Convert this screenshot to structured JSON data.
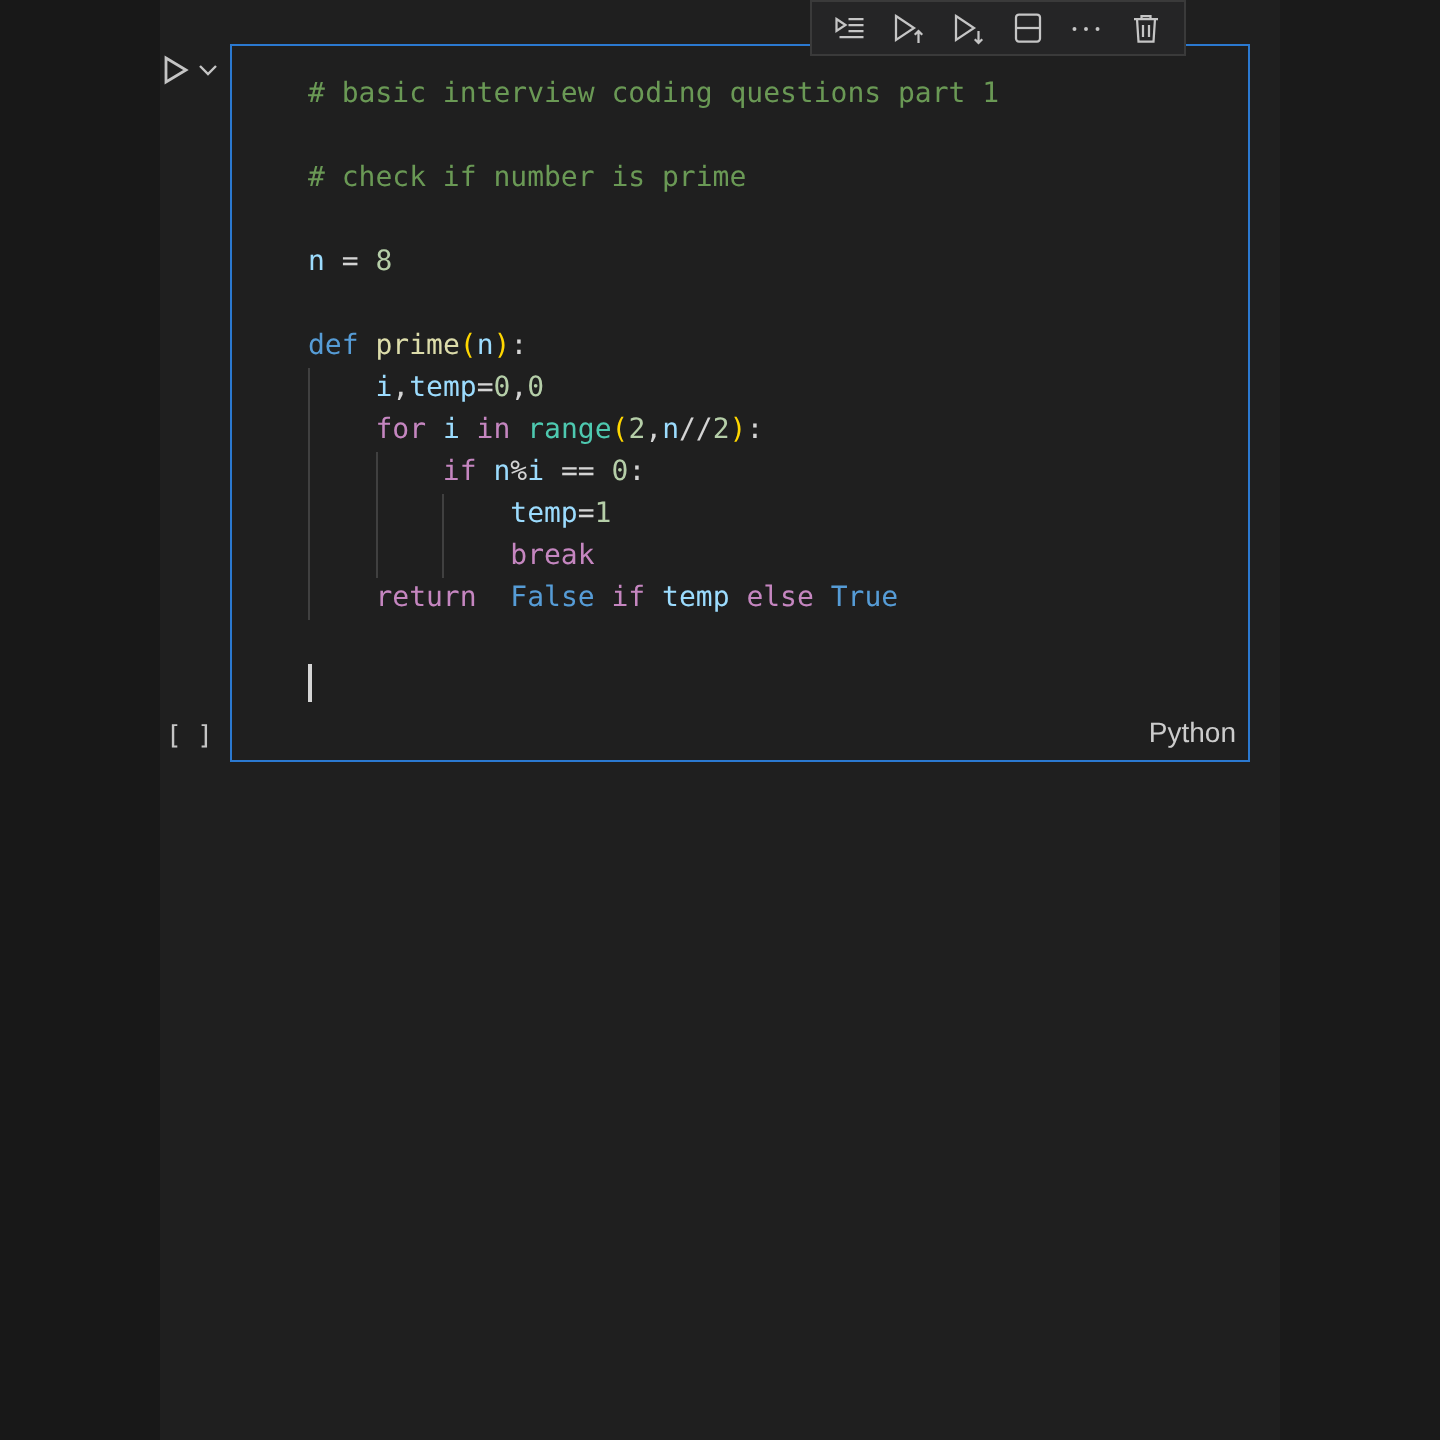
{
  "toolbar": {
    "buttons": [
      {
        "kind": "run-by-line"
      },
      {
        "kind": "run-above"
      },
      {
        "kind": "run-below"
      },
      {
        "kind": "split"
      },
      {
        "kind": "more"
      },
      {
        "kind": "delete"
      }
    ]
  },
  "cell": {
    "selected": true,
    "execution_count": "[ ]",
    "language": "Python",
    "lines": [
      {
        "kind": "code",
        "tokens": [
          {
            "text": "# basic interview coding questions part 1",
            "kind": "comment"
          }
        ]
      },
      {
        "kind": "blank"
      },
      {
        "kind": "code",
        "tokens": [
          {
            "text": "# check if number is prime",
            "kind": "comment"
          }
        ]
      },
      {
        "kind": "blank"
      },
      {
        "kind": "code",
        "tokens": [
          {
            "text": "n",
            "kind": "variable"
          },
          {
            "text": " = ",
            "kind": "plain"
          },
          {
            "text": "8",
            "kind": "number"
          }
        ]
      },
      {
        "kind": "blank"
      },
      {
        "kind": "code",
        "tokens": [
          {
            "text": "def",
            "kind": "storage"
          },
          {
            "text": " prime",
            "kind": "function"
          },
          {
            "text": "(",
            "kind": "bracket"
          },
          {
            "text": "n",
            "kind": "variable"
          },
          {
            "text": ")",
            "kind": "bracket"
          },
          {
            "text": ":",
            "kind": "plain"
          }
        ]
      },
      {
        "kind": "code",
        "tokens": [
          {
            "text": "    i",
            "kind": "variable"
          },
          {
            "text": ",",
            "kind": "plain"
          },
          {
            "text": "temp",
            "kind": "variable"
          },
          {
            "text": "=",
            "kind": "plain"
          },
          {
            "text": "0",
            "kind": "number"
          },
          {
            "text": ",",
            "kind": "plain"
          },
          {
            "text": "0",
            "kind": "number"
          }
        ]
      },
      {
        "kind": "code",
        "tokens": [
          {
            "text": "    for",
            "kind": "control"
          },
          {
            "text": " i",
            "kind": "variable"
          },
          {
            "text": " in",
            "kind": "control"
          },
          {
            "text": " range",
            "kind": "builtin"
          },
          {
            "text": "(",
            "kind": "bracket"
          },
          {
            "text": "2",
            "kind": "number"
          },
          {
            "text": ",",
            "kind": "plain"
          },
          {
            "text": "n",
            "kind": "variable"
          },
          {
            "text": "//",
            "kind": "plain"
          },
          {
            "text": "2",
            "kind": "number"
          },
          {
            "text": ")",
            "kind": "bracket"
          },
          {
            "text": ":",
            "kind": "plain"
          }
        ]
      },
      {
        "kind": "code",
        "tokens": [
          {
            "text": "        if",
            "kind": "control"
          },
          {
            "text": " n",
            "kind": "variable"
          },
          {
            "text": "%",
            "kind": "plain"
          },
          {
            "text": "i",
            "kind": "variable"
          },
          {
            "text": " == ",
            "kind": "plain"
          },
          {
            "text": "0",
            "kind": "number"
          },
          {
            "text": ":",
            "kind": "plain"
          }
        ]
      },
      {
        "kind": "code",
        "tokens": [
          {
            "text": "            temp",
            "kind": "variable"
          },
          {
            "text": "=",
            "kind": "plain"
          },
          {
            "text": "1",
            "kind": "number"
          }
        ]
      },
      {
        "kind": "code",
        "tokens": [
          {
            "text": "            break",
            "kind": "control"
          }
        ]
      },
      {
        "kind": "code",
        "tokens": [
          {
            "text": "    return",
            "kind": "control"
          },
          {
            "text": "  False",
            "kind": "constant"
          },
          {
            "text": " if",
            "kind": "control"
          },
          {
            "text": " temp",
            "kind": "variable"
          },
          {
            "text": " else",
            "kind": "control"
          },
          {
            "text": " True",
            "kind": "constant"
          }
        ]
      },
      {
        "kind": "blank"
      },
      {
        "kind": "cursor"
      }
    ]
  }
}
